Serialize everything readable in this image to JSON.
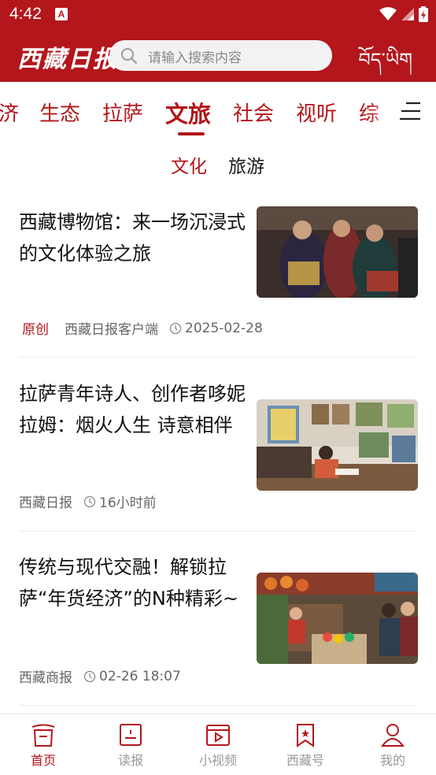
{
  "status_bar": {
    "time": "4:42",
    "notification_glyph": "A"
  },
  "header": {
    "logo_text": "西藏日报",
    "search_placeholder": "请输入搜索内容",
    "tibetan_label": "བོད་ཡིག",
    "bg_color": "#b3161b"
  },
  "category_tabs": [
    {
      "label": "济",
      "active": false
    },
    {
      "label": "生态",
      "active": false
    },
    {
      "label": "拉萨",
      "active": false
    },
    {
      "label": "文旅",
      "active": true
    },
    {
      "label": "社会",
      "active": false
    },
    {
      "label": "视听",
      "active": false
    },
    {
      "label": "综",
      "active": false
    }
  ],
  "sub_tabs": [
    {
      "label": "文化",
      "active": true
    },
    {
      "label": "旅游",
      "active": false
    }
  ],
  "articles": [
    {
      "title": "西藏博物馆：来一场沉浸式的文化体验之旅",
      "tag": "原创",
      "source": "西藏日报客户端",
      "time": "2025-02-28"
    },
    {
      "title": "拉萨青年诗人、创作者哆妮拉姆：烟火人生 诗意相伴",
      "tag": "",
      "source": "西藏日报",
      "time": "16小时前"
    },
    {
      "title": "传统与现代交融！解锁拉萨“年货经济”的N种精彩~",
      "tag": "",
      "source": "西藏商报",
      "time": "02-26 18:07"
    }
  ],
  "bottom_nav": [
    {
      "label": "首页",
      "icon": "home-icon",
      "active": true
    },
    {
      "label": "读报",
      "icon": "newspaper-icon",
      "active": false
    },
    {
      "label": "小视频",
      "icon": "video-icon",
      "active": false
    },
    {
      "label": "西藏号",
      "icon": "bookmark-icon",
      "active": false
    },
    {
      "label": "我的",
      "icon": "user-icon",
      "active": false
    }
  ],
  "colors": {
    "accent": "#b3161b",
    "inactive": "#999999"
  }
}
